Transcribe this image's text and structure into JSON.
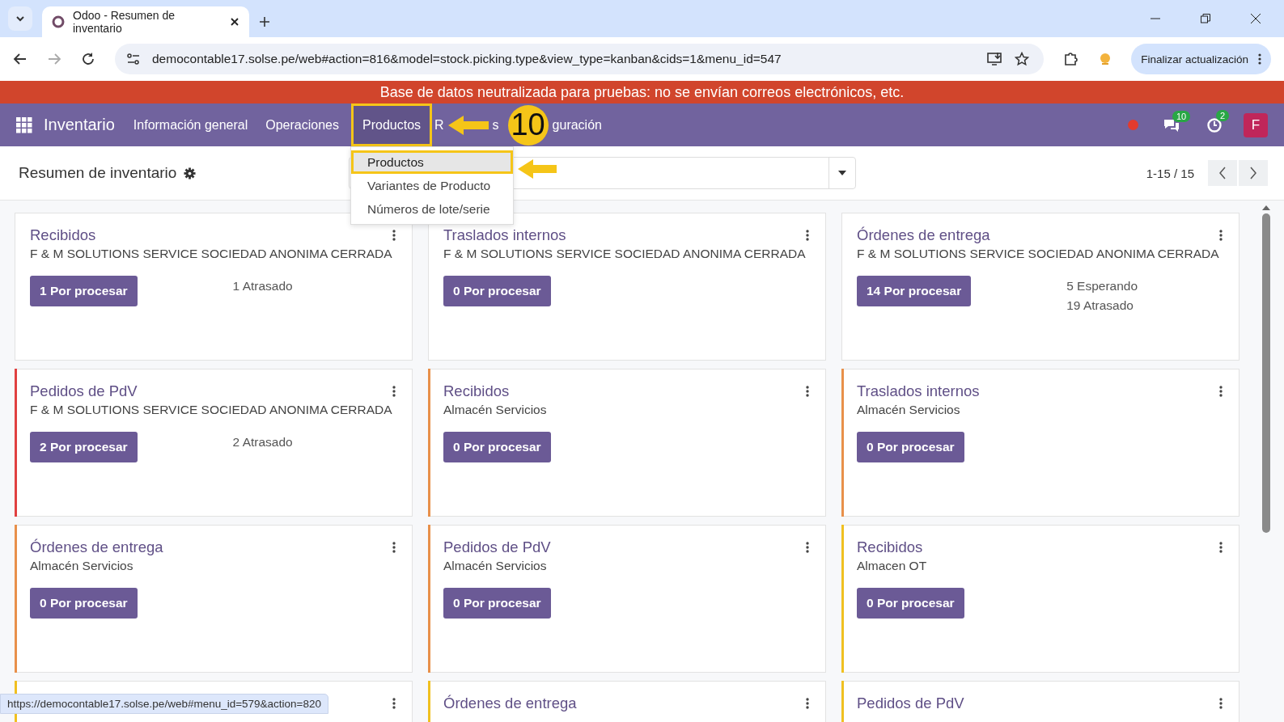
{
  "browser": {
    "tab_title": "Odoo - Resumen de inventario",
    "url": "democontable17.solse.pe/web#action=816&model=stock.picking.type&view_type=kanban&cids=1&menu_id=547",
    "update_button": "Finalizar actualización"
  },
  "banner": "Base de datos neutralizada para pruebas: no se envían correos electrónicos, etc.",
  "navbar": {
    "app_name": "Inventario",
    "items": [
      {
        "label": "Información general",
        "selected": false
      },
      {
        "label": "Operaciones",
        "selected": false
      },
      {
        "label": "Productos",
        "selected": true
      },
      {
        "label": "R",
        "selected": false
      },
      {
        "label": "s",
        "selected": false
      },
      {
        "label": "guración",
        "selected": false
      }
    ],
    "messages_count": "10",
    "activities_count": "2",
    "avatar": "F"
  },
  "dropdown": [
    {
      "label": "Productos",
      "selected": true
    },
    {
      "label": "Variantes de Producto",
      "selected": false
    },
    {
      "label": "Números de lote/serie",
      "selected": false
    }
  ],
  "annotation": {
    "step": "10"
  },
  "control_panel": {
    "title": "Resumen de inventario",
    "pager": "1-15 / 15"
  },
  "cards": [
    {
      "title": "Recibidos",
      "subtitle": "F & M SOLUTIONS SERVICE SOCIEDAD ANONIMA CERRADA",
      "button": "1 Por procesar",
      "stats": [
        "1 Atrasado"
      ]
    },
    {
      "title": "Traslados internos",
      "subtitle": "F & M SOLUTIONS SERVICE SOCIEDAD ANONIMA CERRADA",
      "button": "0 Por procesar"
    },
    {
      "title": "Órdenes de entrega",
      "subtitle": "F & M SOLUTIONS SERVICE SOCIEDAD ANONIMA CERRADA",
      "button": "14 Por procesar",
      "stats": [
        "5 Esperando",
        "19 Atrasado"
      ]
    },
    {
      "title": "Pedidos de PdV",
      "subtitle": "F & M SOLUTIONS SERVICE SOCIEDAD ANONIMA CERRADA",
      "button": "2 Por procesar",
      "stats": [
        "2 Atrasado"
      ],
      "color": "#e04040"
    },
    {
      "title": "Recibidos",
      "subtitle": "Almacén Servicios",
      "button": "0 Por procesar",
      "color": "#e8904a"
    },
    {
      "title": "Traslados internos",
      "subtitle": "Almacén Servicios",
      "button": "0 Por procesar",
      "color": "#e8904a"
    },
    {
      "title": "Órdenes de entrega",
      "subtitle": "Almacén Servicios",
      "button": "0 Por procesar",
      "color": "#e8904a"
    },
    {
      "title": "Pedidos de PdV",
      "subtitle": "Almacén Servicios",
      "button": "0 Por procesar",
      "color": "#e8904a"
    },
    {
      "title": "Recibidos",
      "subtitle": "Almacen OT",
      "button": "0 Por procesar",
      "color": "#f0c020"
    },
    {
      "color": "#f0c020"
    },
    {
      "title": "Órdenes de entrega",
      "color": "#f0c020"
    },
    {
      "title": "Pedidos de PdV",
      "color": "#f0c020"
    }
  ],
  "status_url": "https://democontable17.solse.pe/web#menu_id=579&action=820"
}
